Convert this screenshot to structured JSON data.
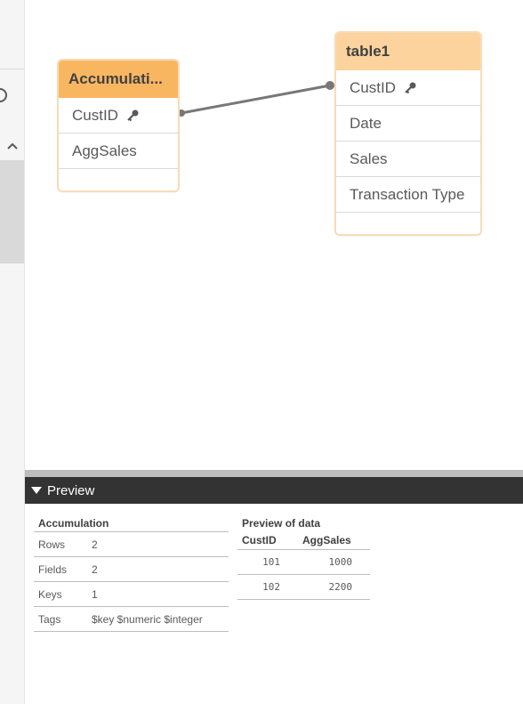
{
  "model_viewer": {
    "tables": [
      {
        "name": "Accumulati...",
        "fields": [
          {
            "label": "CustID",
            "key": true
          },
          {
            "label": "AggSales",
            "key": false
          }
        ]
      },
      {
        "name": "table1",
        "fields": [
          {
            "label": "CustID",
            "key": true
          },
          {
            "label": "Date",
            "key": false
          },
          {
            "label": "Sales",
            "key": false
          },
          {
            "label": "Transaction Type",
            "key": false
          }
        ]
      }
    ]
  },
  "preview": {
    "bar_label": "Preview",
    "meta": {
      "title": "Accumulation",
      "rows": [
        {
          "key": "Rows",
          "value": "2"
        },
        {
          "key": "Fields",
          "value": "2"
        },
        {
          "key": "Keys",
          "value": "1"
        },
        {
          "key": "Tags",
          "value": "$key $numeric $integer"
        }
      ]
    },
    "data": {
      "title": "Preview of data",
      "columns": [
        "CustID",
        "AggSales"
      ],
      "rows": [
        [
          "101",
          "1000"
        ],
        [
          "102",
          "2200"
        ]
      ]
    }
  },
  "colors": {
    "accumulation_header": "#f9b661",
    "table1_header": "#fcd39d",
    "preview_bar": "#333333",
    "link_line": "#777777"
  },
  "icons": {
    "key": "key-icon",
    "collapse": "triangle-down-icon",
    "chevron": "chevron-up-icon"
  }
}
